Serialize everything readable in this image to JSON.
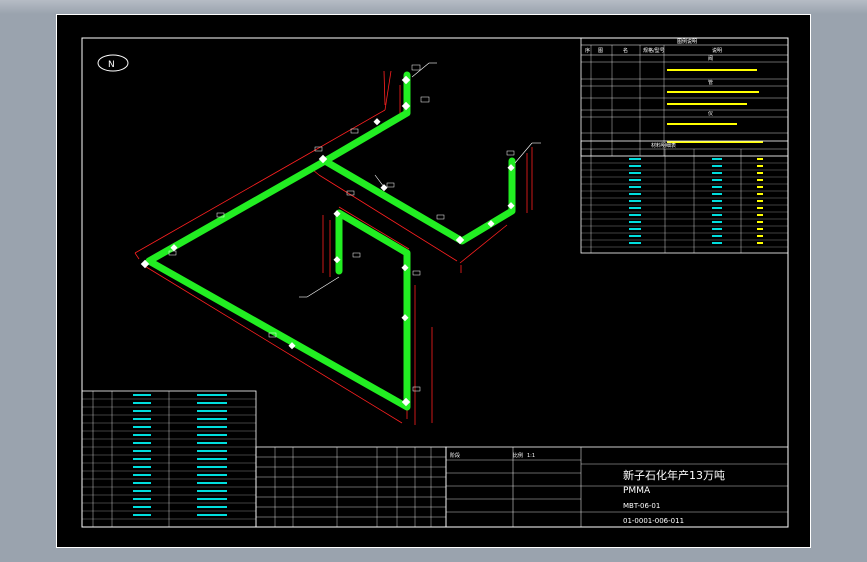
{
  "drawing": {
    "north_mark": "N",
    "pipe_color": "#22ee22",
    "dim_color": "#ff2020",
    "border_color": "#ffffff",
    "background": "#000000"
  },
  "legend_table": {
    "title": "图例说明",
    "header": [
      "序",
      "图",
      "名",
      "规格/型号",
      "说明"
    ],
    "sections": [
      "阀",
      "管",
      "仪"
    ]
  },
  "parts_table": {
    "title": "材料明细表"
  },
  "title_block": {
    "project": "新子石化年产13万吨",
    "subtitle": "PMMA",
    "drawing_code": "MBT-06-01",
    "drawing_no": "01-0001-006-011",
    "scale_label": "比例",
    "scale_value": "1:1",
    "stage_label": "阶段"
  }
}
